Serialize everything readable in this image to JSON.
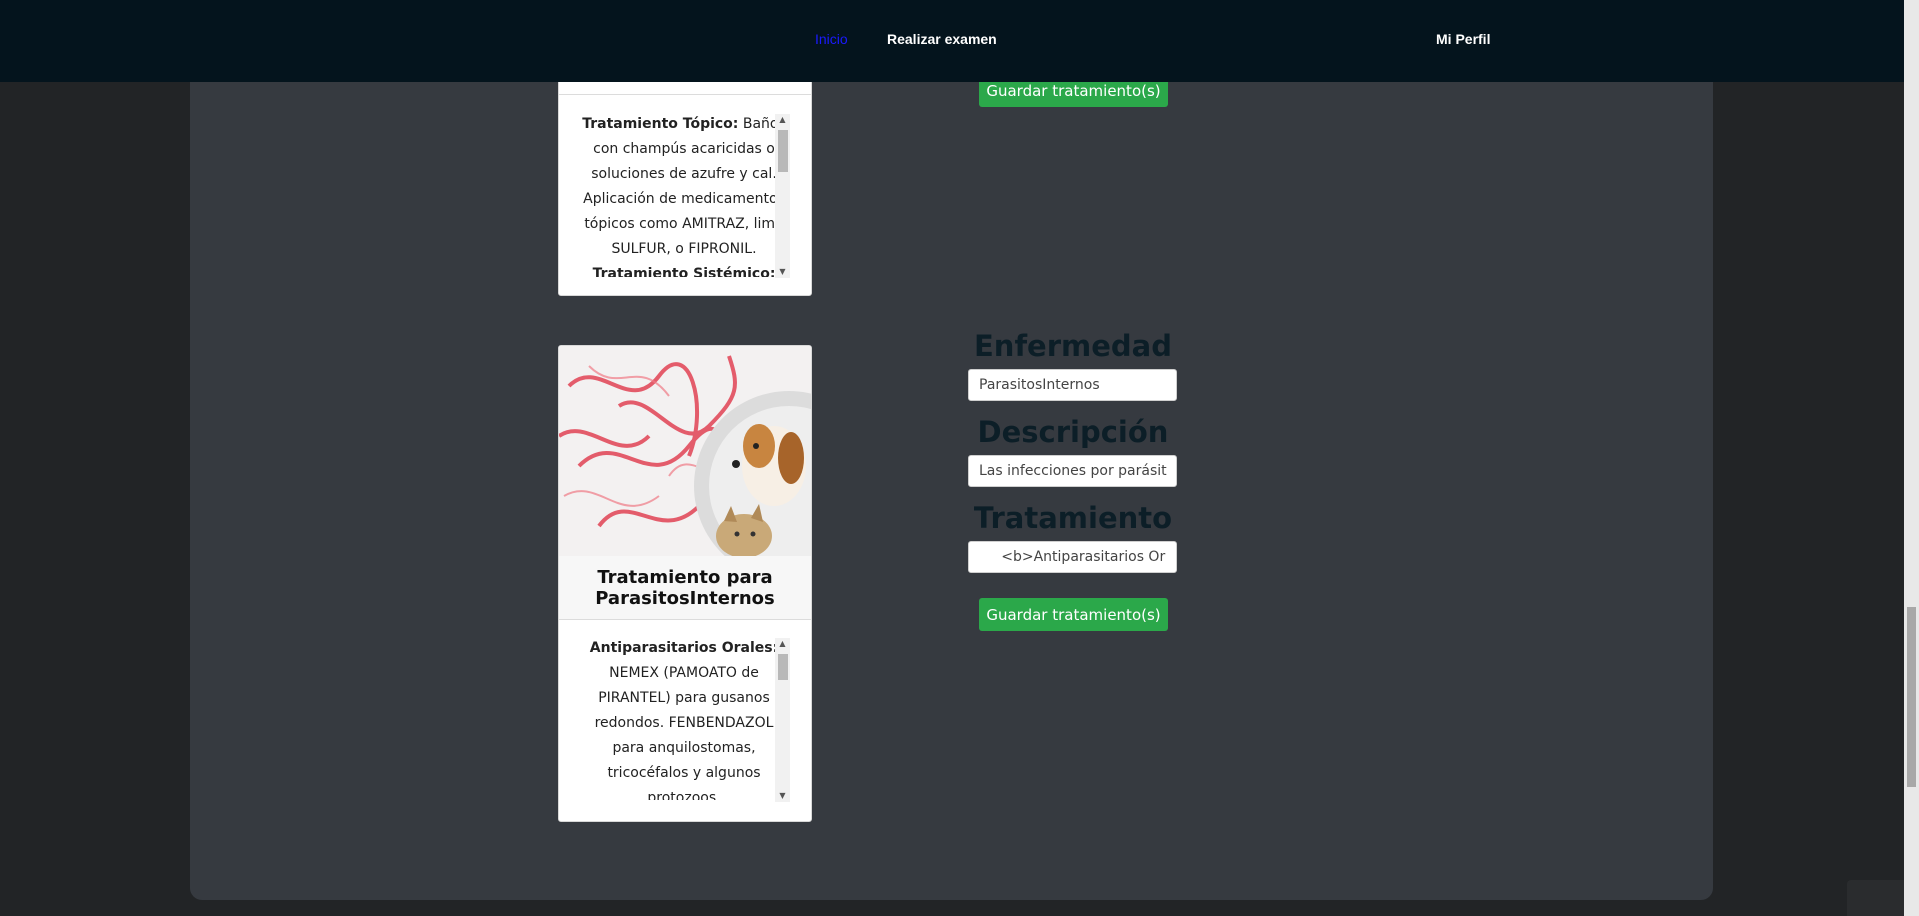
{
  "nav": {
    "items": [
      "Inicio",
      "Realizar examen"
    ],
    "profile": "Mi Perfil"
  },
  "card_top": {
    "body": {
      "heading": "Tratamiento Tópico:",
      "text": "Baños con champús acaricidas o soluciones de azufre y cal. Aplicación de medicamentos tópicos como AMITRAZ, lime SULFUR, o FIPRONIL.",
      "heading2": "Tratamiento Sistémico:"
    }
  },
  "form_top": {
    "save_label": "Guardar tratamiento(s)"
  },
  "card_bottom": {
    "image_icon": "parasites-dog-cat-image",
    "title": "Tratamiento para ParasitosInternos",
    "body": {
      "heading": "Antiparasitarios Orales:",
      "text": "NEMEX (PAMOATO de PIRANTEL) para gusanos redondos. FENBENDAZOL para anquilostomas, tricocéfalos y algunos protozoos."
    }
  },
  "form_bottom": {
    "disease_label": "Enfermedad",
    "disease_value": "ParasitosInternos",
    "description_label": "Descripción",
    "description_value": "Las infecciones por parásit",
    "treatment_label": "Tratamiento",
    "treatment_value": "     <b>Antiparasitarios Or",
    "save_label": "Guardar tratamiento(s)"
  },
  "colors": {
    "navbar": "#04141d",
    "panel": "#363a40",
    "active_link": "#1a1aff",
    "save_button": "#2ba84a"
  }
}
